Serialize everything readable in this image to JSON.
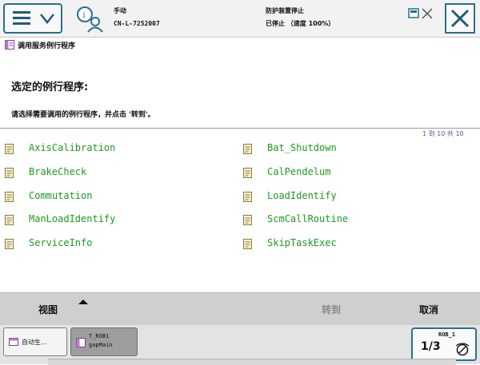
{
  "status": {
    "mode": "手动",
    "controller": "CN-L-7252007",
    "safety_state": "防护装置停止",
    "run_state": "已停止 （速度 100%）"
  },
  "page": {
    "title": "调用服务例行程序",
    "heading": "选定的例行程序:",
    "instruction": "请选择需要调用的例行程序，并点击 '转到'。",
    "pager": "1 到 10 共 10"
  },
  "routines": [
    {
      "label": "AxisCalibration"
    },
    {
      "label": "Bat_Shutdown"
    },
    {
      "label": "BrakeCheck"
    },
    {
      "label": "CalPendelum"
    },
    {
      "label": "Commutation"
    },
    {
      "label": "LoadIdentify"
    },
    {
      "label": "ManLoadIdentify"
    },
    {
      "label": "ScmCallRoutine"
    },
    {
      "label": "ServiceInfo"
    },
    {
      "label": "SkipTaskExec"
    }
  ],
  "commands": {
    "view": "视图",
    "goto": "转到",
    "cancel": "取消"
  },
  "taskbar": {
    "task1_label": "自动生...",
    "task2_line1": "T_ROB1",
    "task2_line2": "gapMain",
    "quickset_unit": "ROB_1",
    "quickset_fraction": "1/3"
  },
  "icons": {
    "menu": "hamburger-menu-icon",
    "status": "operator-status-icon",
    "close": "close-icon",
    "routine": "program-routine-icon",
    "quickset": "speed-quickset-icon"
  },
  "colors": {
    "routine_text": "#1e9a20",
    "accent_border": "#2b6e8e",
    "pager_text": "#5a5aa8",
    "disabled_text": "#8a8a8a"
  }
}
